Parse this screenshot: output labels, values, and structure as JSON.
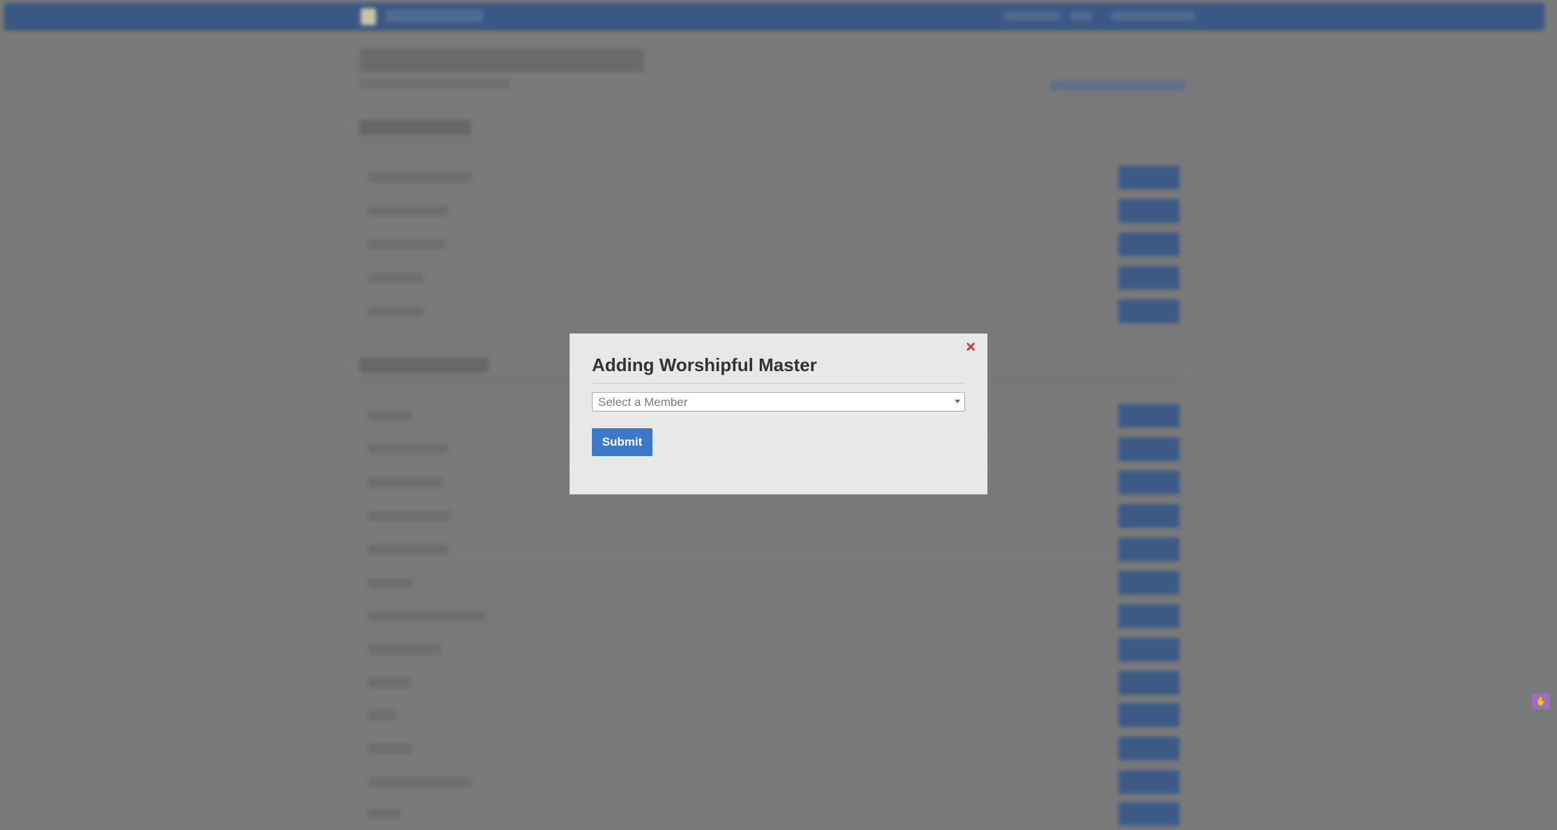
{
  "modal": {
    "title": "Adding Worshipful Master",
    "select_placeholder": "Select a Member",
    "submit_label": "Submit",
    "close_glyph": "×"
  },
  "colors": {
    "navbar": "#3a5883",
    "button": "#3d5a87",
    "submit": "#3d78c9",
    "close": "#c9302c"
  },
  "icons": [
    "close-icon",
    "chevron-down-icon",
    "widget-icon"
  ]
}
